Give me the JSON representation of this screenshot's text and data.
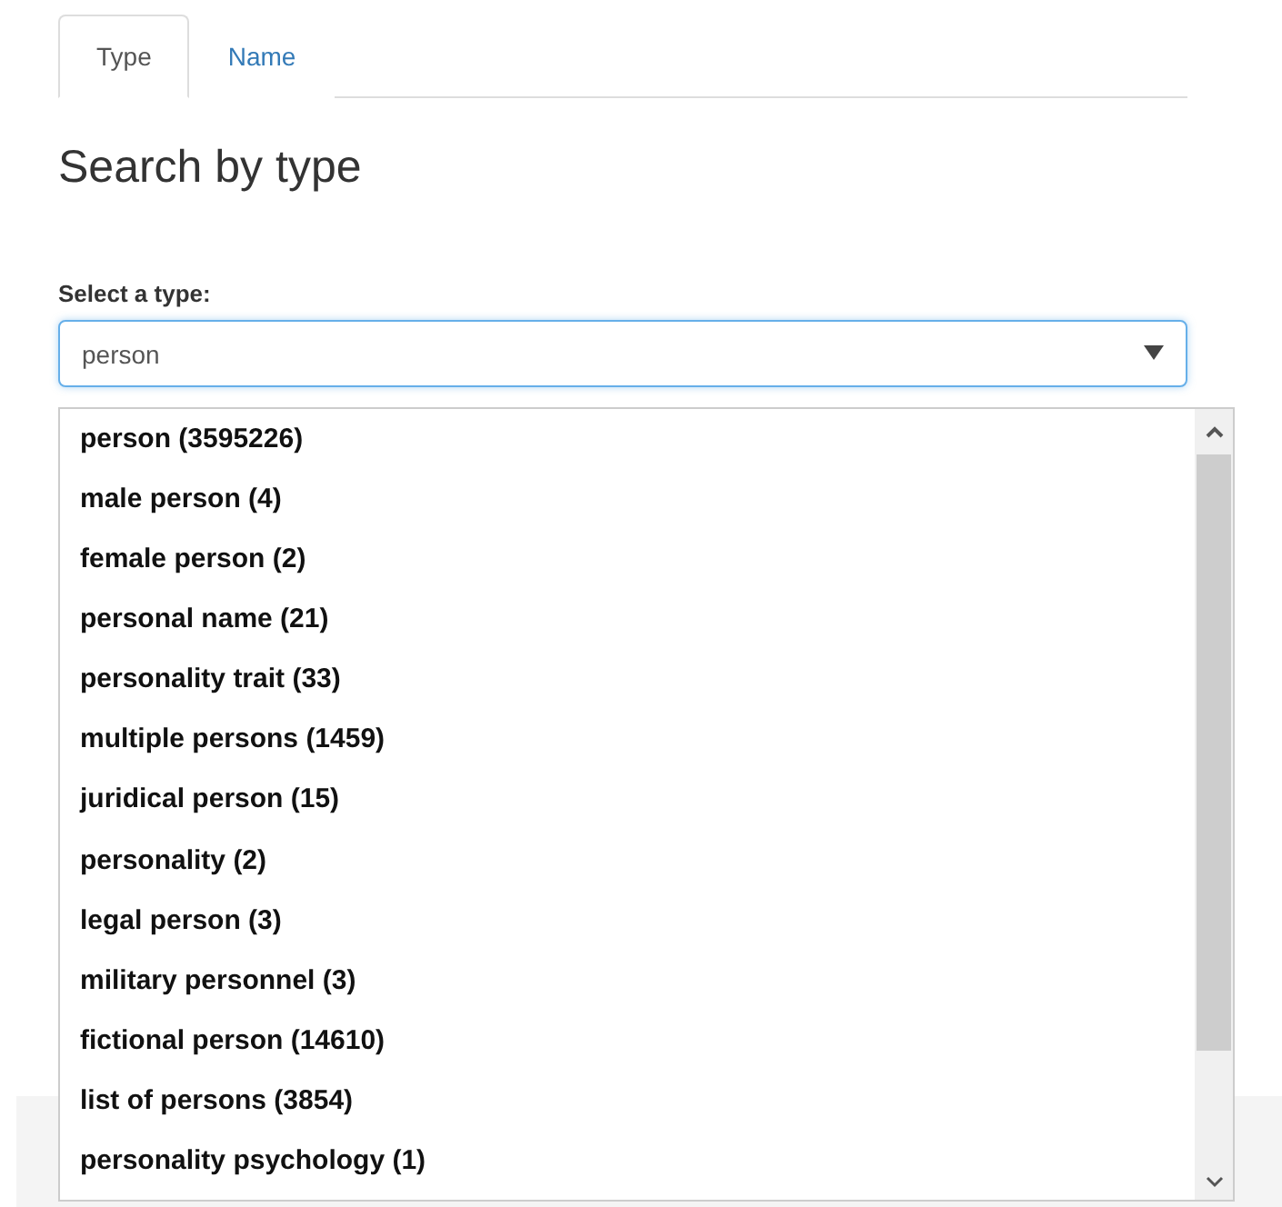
{
  "tabs": [
    {
      "label": "Type",
      "selected": true
    },
    {
      "label": "Name",
      "selected": false
    }
  ],
  "heading": "Search by type",
  "field": {
    "label": "Select a type:",
    "value": "person"
  },
  "options": [
    {
      "label": "person (3595226)"
    },
    {
      "label": "male person (4)"
    },
    {
      "label": "female person (2)"
    },
    {
      "label": "personal name (21)"
    },
    {
      "label": "personality trait (33)"
    },
    {
      "label": "multiple persons (1459)"
    },
    {
      "label": "juridical person (15)"
    },
    {
      "label": "personality (2)"
    },
    {
      "label": "legal person (3)"
    },
    {
      "label": "military personnel (3)"
    },
    {
      "label": "fictional person (14610)"
    },
    {
      "label": "list of persons (3854)"
    },
    {
      "label": "personality psychology (1)"
    }
  ]
}
